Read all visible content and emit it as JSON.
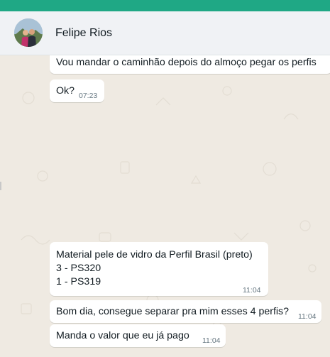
{
  "header": {
    "contact_name": "Felipe Rios"
  },
  "messages": [
    {
      "text": "Vou mandar o caminhão depois do almoço pegar os perfis",
      "time": ""
    },
    {
      "text": "Ok?",
      "time": "07:23"
    },
    {
      "lines": [
        "Material pele de vidro da Perfil Brasil (preto)",
        "3 - PS320",
        "1 - PS319"
      ],
      "time": "11:04"
    },
    {
      "text": "Bom dia, consegue separar pra mim esses 4 perfis?",
      "time": "11:04"
    },
    {
      "text": "Manda o valor que eu já pago",
      "time": "11:04"
    }
  ],
  "colors": {
    "top_bar": "#1fa885",
    "chat_background": "#efeae2",
    "bubble_incoming": "#ffffff"
  }
}
